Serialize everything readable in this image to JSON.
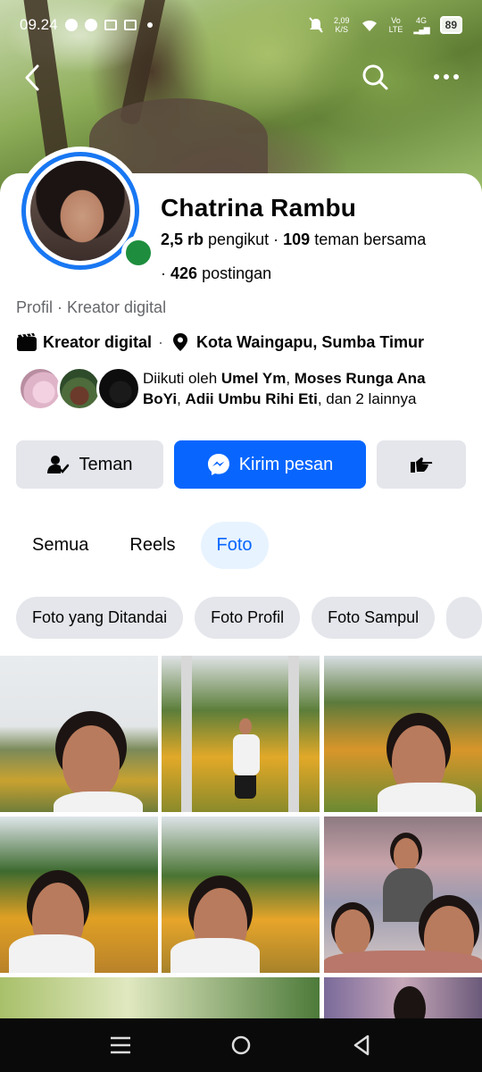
{
  "status_bar": {
    "time": "09.24",
    "net_speed_top": "2,09",
    "net_speed_bottom": "K/S",
    "volte_top": "Vo",
    "volte_bottom": "LTE",
    "network": "4G",
    "battery": "89"
  },
  "profile": {
    "name": "Chatrina Rambu",
    "followers_count": "2,5 rb",
    "followers_label": "pengikut",
    "mutual_count": "109",
    "mutual_label": "teman bersama",
    "posts_count": "426",
    "posts_label": "postingan",
    "category_line": "Profil · Kreator digital",
    "creator_label": "Kreator digital",
    "location": "Kota Waingapu, Sumba Timur",
    "followed_prefix": "Diikuti oleh",
    "followed_name1": "Umel Ym",
    "followed_name2": "Moses Runga Ana BoYi",
    "followed_name3": "Adii Umbu Rihi Eti",
    "followed_suffix": "dan 2 lainnya"
  },
  "buttons": {
    "friends": "Teman",
    "message": "Kirim pesan"
  },
  "tabs": [
    {
      "label": "Semua"
    },
    {
      "label": "Reels"
    },
    {
      "label": "Foto"
    }
  ],
  "chips": [
    {
      "label": "Foto yang Ditandai"
    },
    {
      "label": "Foto Profil"
    },
    {
      "label": "Foto Sampul"
    }
  ],
  "colors": {
    "accent": "#0866ff",
    "online": "#1e8e3e",
    "button_gray": "#e4e6eb",
    "tab_active_bg": "#e7f3ff"
  }
}
